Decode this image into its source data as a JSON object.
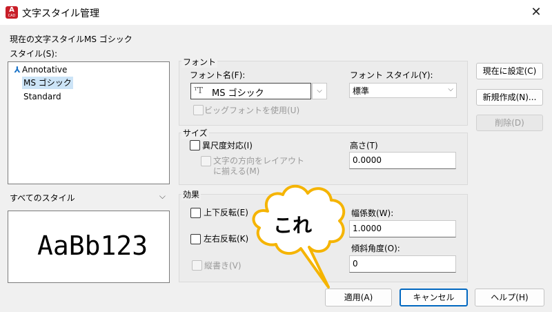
{
  "window": {
    "icon_label": "A",
    "icon_sub": "CAD",
    "title": "文字スタイル管理",
    "close_glyph": "✕"
  },
  "current_style": "現在の文字スタイルMS ゴシック",
  "styles_label": "スタイル(S):",
  "styles": [
    {
      "name": "Annotative",
      "icon": "annotative-icon",
      "selected": false
    },
    {
      "name": "MS ゴシック",
      "icon": "",
      "selected": true
    },
    {
      "name": "Standard",
      "icon": "",
      "selected": false
    }
  ],
  "filter": {
    "value": "すべてのスタイル",
    "arrow": "⌵"
  },
  "preview": {
    "text": "AaBb123"
  },
  "font_group": {
    "title": "フォント",
    "font_name_label": "フォント名(F):",
    "font_name_icon": "ᵀT",
    "font_name_value": "MS ゴシック",
    "font_style_label": "フォント スタイル(Y):",
    "font_style_value": "標準",
    "bigfont_label": "ビッグフォントを使用(U)"
  },
  "size_group": {
    "title": "サイズ",
    "annotative_label": "異尺度対応(I)",
    "match_orientation_line1": "文字の方向をレイアウト",
    "match_orientation_line2": "に揃える(M)",
    "height_label": "高さ(T)",
    "height_value": "0.0000"
  },
  "effects_group": {
    "title": "効果",
    "upside_down_label": "上下反転(E)",
    "backwards_label": "左右反転(K)",
    "vertical_label": "縦書き(V)",
    "width_factor_label": "幅係数(W):",
    "width_factor_value": "1.0000",
    "oblique_label": "傾斜角度(O):",
    "oblique_value": "0"
  },
  "side_buttons": {
    "set_current": "現在に設定(C)",
    "new": "新規作成(N)...",
    "delete": "削除(D)"
  },
  "bottom_buttons": {
    "apply": "適用(A)",
    "cancel": "キャンセル",
    "help": "ヘルプ(H)"
  },
  "annotation": {
    "text": "これ",
    "fill": "#ffffff",
    "stroke": "#f5b400"
  }
}
